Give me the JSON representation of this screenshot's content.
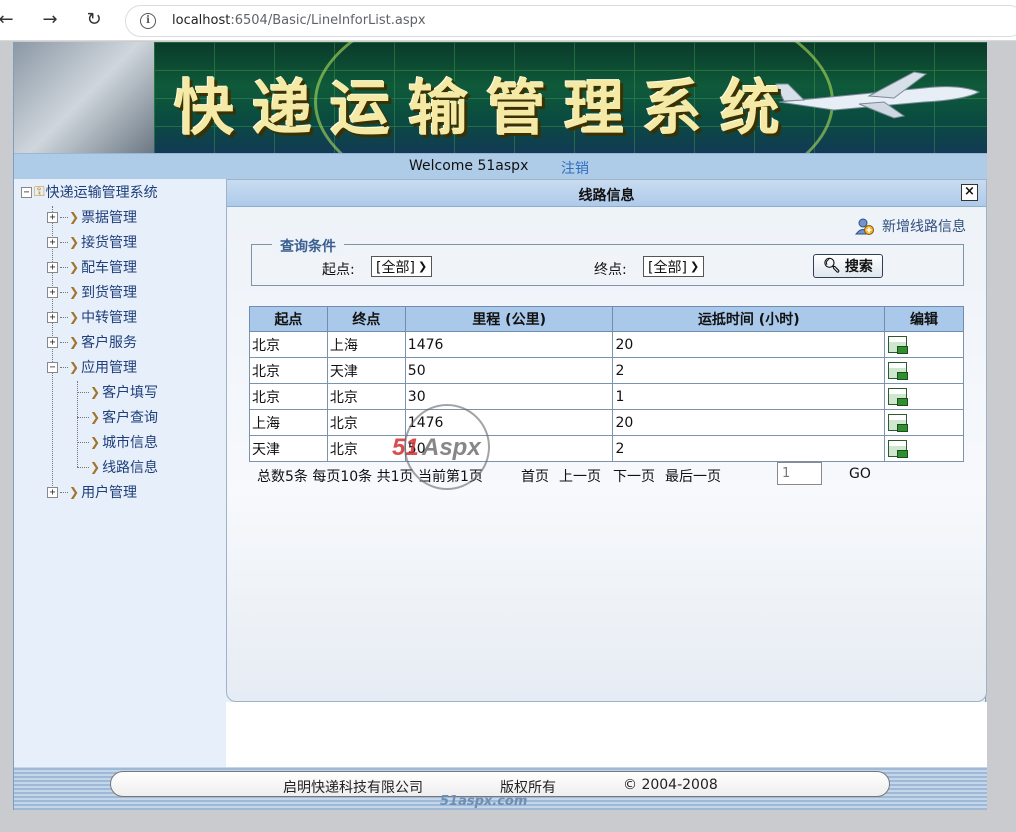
{
  "browser": {
    "url_host": "localhost",
    "url_rest": ":6504/Basic/LineInforList.aspx"
  },
  "header": {
    "banner_title": "快递运输管理系统",
    "welcome": "Welcome 51aspx",
    "logout": "注销"
  },
  "sidebar": {
    "root": "快递运输管理系统",
    "items": [
      {
        "label": "票据管理"
      },
      {
        "label": "接货管理"
      },
      {
        "label": "配车管理"
      },
      {
        "label": "到货管理"
      },
      {
        "label": "中转管理"
      },
      {
        "label": "客户服务"
      },
      {
        "label": "应用管理"
      },
      {
        "label": "用户管理"
      }
    ],
    "sub_items": [
      {
        "label": "客户填写"
      },
      {
        "label": "客户查询"
      },
      {
        "label": "城市信息"
      },
      {
        "label": "线路信息"
      }
    ]
  },
  "panel": {
    "title": "线路信息",
    "close": "×",
    "add_link": "新增线路信息"
  },
  "query": {
    "legend": "查询条件",
    "start_label": "起点:",
    "start_value": "[全部]",
    "end_label": "终点:",
    "end_value": "[全部]",
    "search_button": "搜索"
  },
  "table": {
    "headers": [
      "起点",
      "终点",
      "里程 (公里)",
      "运抵时间 (小时)",
      "编辑"
    ],
    "rows": [
      [
        "北京",
        "上海",
        "1476",
        "20"
      ],
      [
        "北京",
        "天津",
        "50",
        "2"
      ],
      [
        "北京",
        "北京",
        "30",
        "1"
      ],
      [
        "上海",
        "北京",
        "1476",
        "20"
      ],
      [
        "天津",
        "北京",
        "50",
        "2"
      ]
    ]
  },
  "pager": {
    "summary": "总数5条 每页10条 共1页 当前第1页",
    "first": "首页",
    "prev": "上一页",
    "next": "下一页",
    "last": "最后一页",
    "page_value": "1",
    "go": "GO"
  },
  "watermark": {
    "brand_left": "51",
    "brand_right": "Aspx"
  },
  "footer": {
    "company": "启明快递科技有限公司",
    "rights": "版权所有",
    "copyright": "© 2004-2008",
    "brand": "51aspx.com"
  }
}
